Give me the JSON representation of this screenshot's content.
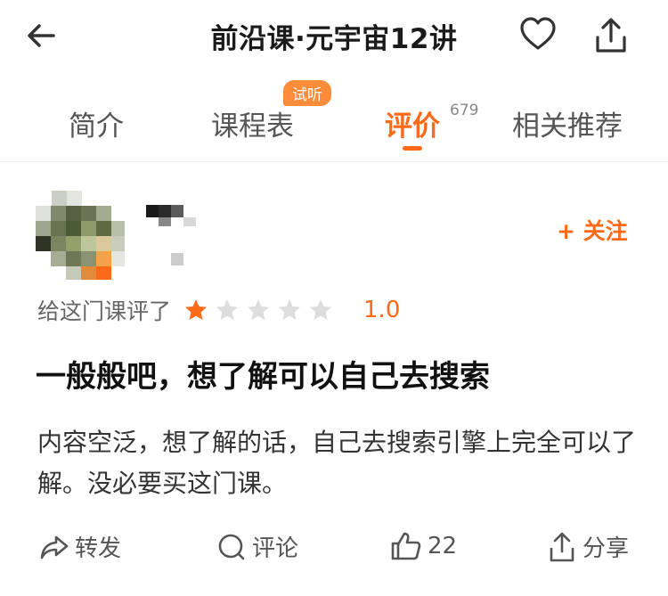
{
  "header": {
    "title": "前沿课·元宇宙12讲"
  },
  "tabs": [
    {
      "label": "简介"
    },
    {
      "label": "课程表",
      "badge": "试听"
    },
    {
      "label": "评价",
      "count": "679"
    },
    {
      "label": "相关推荐"
    }
  ],
  "review": {
    "follow_label": "+ 关注",
    "rating_prefix": "给这门课评了",
    "stars_filled": 1,
    "stars_total": 5,
    "score": "1.0",
    "title": "一般般吧，想了解可以自己去搜索",
    "body": "内容空泛，想了解的话，自己去搜索引擎上完全可以了解。没必要买这门课。"
  },
  "actions": {
    "forward": "转发",
    "comment": "评论",
    "like": "22",
    "share": "分享"
  },
  "colors": {
    "accent": "#ff6a1a",
    "badge": "#ff8c3a",
    "star_empty": "#dddddd"
  }
}
